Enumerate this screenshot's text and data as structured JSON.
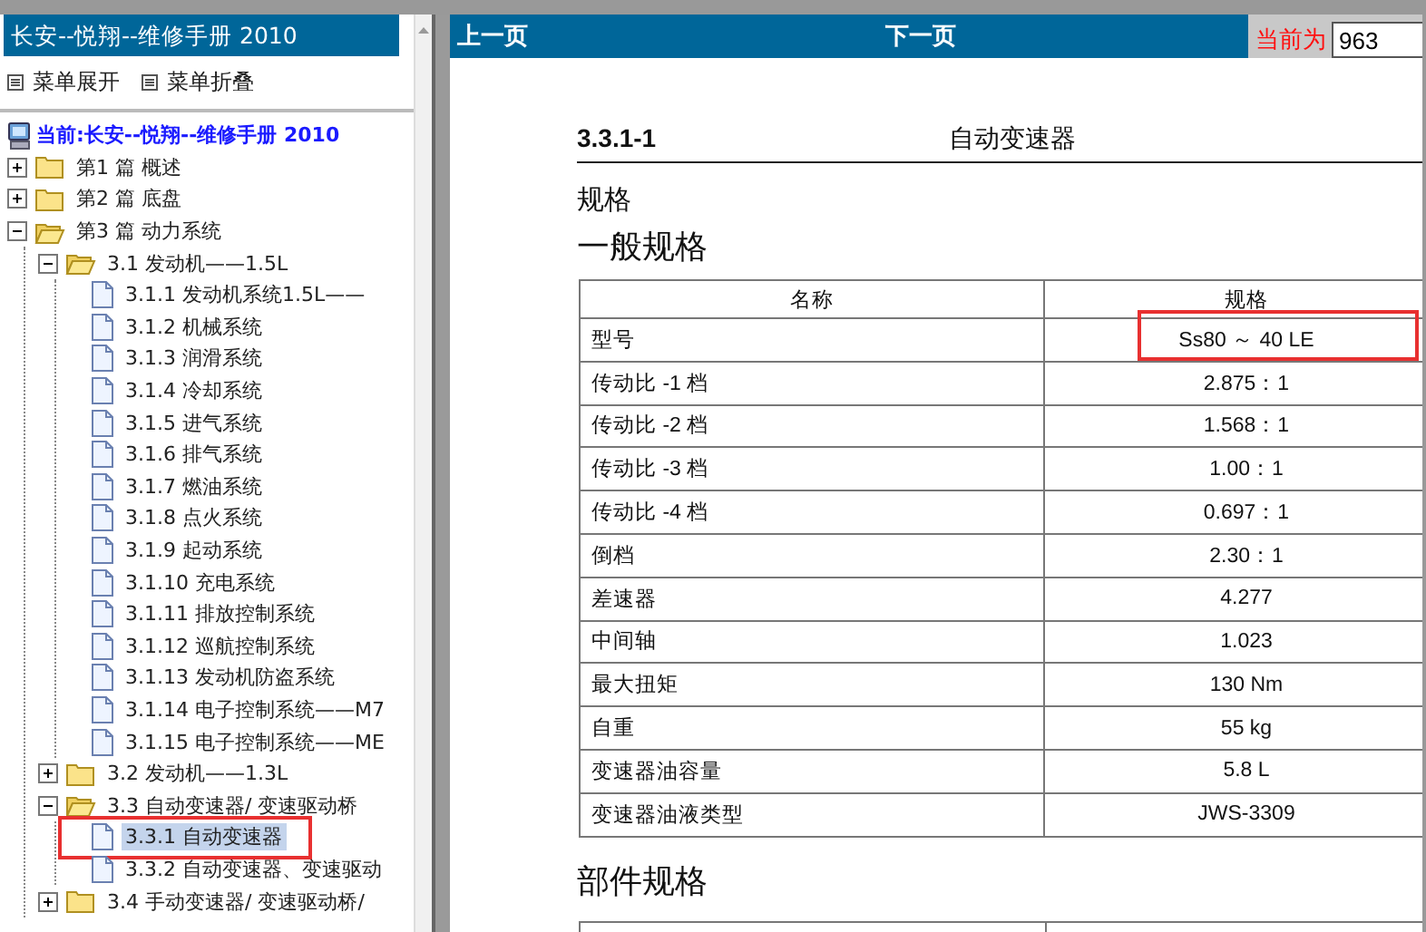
{
  "sidebar": {
    "title": "长安--悦翔--维修手册 2010",
    "menu_buttons": [
      "菜单展开",
      "菜单折叠"
    ],
    "root": "当前:长安--悦翔--维修手册 2010",
    "tree": [
      {
        "kind": "folder",
        "label": "第1 篇 概述",
        "expanded": false
      },
      {
        "kind": "folder",
        "label": "第2 篇 底盘",
        "expanded": false
      },
      {
        "kind": "folder",
        "label": "第3 篇 动力系统",
        "expanded": true,
        "children": [
          {
            "kind": "folder",
            "label": "3.1 发动机——1.5L",
            "expanded": true,
            "children": [
              {
                "kind": "page",
                "label": "3.1.1 发动机系统1.5L——",
                "selected": false,
                "annotated": false
              },
              {
                "kind": "page",
                "label": "3.1.2 机械系统",
                "selected": false,
                "annotated": false
              },
              {
                "kind": "page",
                "label": "3.1.3 润滑系统",
                "selected": false,
                "annotated": false
              },
              {
                "kind": "page",
                "label": "3.1.4 冷却系统",
                "selected": false,
                "annotated": false
              },
              {
                "kind": "page",
                "label": "3.1.5 进气系统",
                "selected": false,
                "annotated": false
              },
              {
                "kind": "page",
                "label": "3.1.6 排气系统",
                "selected": false,
                "annotated": false
              },
              {
                "kind": "page",
                "label": "3.1.7 燃油系统",
                "selected": false,
                "annotated": false
              },
              {
                "kind": "page",
                "label": "3.1.8 点火系统",
                "selected": false,
                "annotated": false
              },
              {
                "kind": "page",
                "label": "3.1.9 起动系统",
                "selected": false,
                "annotated": false
              },
              {
                "kind": "page",
                "label": "3.1.10 充电系统",
                "selected": false,
                "annotated": false
              },
              {
                "kind": "page",
                "label": "3.1.11 排放控制系统",
                "selected": false,
                "annotated": false
              },
              {
                "kind": "page",
                "label": "3.1.12 巡航控制系统",
                "selected": false,
                "annotated": false
              },
              {
                "kind": "page",
                "label": "3.1.13 发动机防盗系统",
                "selected": false,
                "annotated": false
              },
              {
                "kind": "page",
                "label": "3.1.14 电子控制系统——M7",
                "selected": false,
                "annotated": false
              },
              {
                "kind": "page",
                "label": "3.1.15 电子控制系统——ME",
                "selected": false,
                "annotated": false
              }
            ]
          },
          {
            "kind": "folder",
            "label": "3.2 发动机——1.3L",
            "expanded": false
          },
          {
            "kind": "folder",
            "label": "3.3 自动变速器/ 变速驱动桥",
            "expanded": true,
            "children": [
              {
                "kind": "page",
                "label": "3.3.1 自动变速器",
                "selected": true,
                "annotated": true
              },
              {
                "kind": "page",
                "label": "3.3.2 自动变速器、变速驱动",
                "selected": false,
                "annotated": false
              }
            ]
          },
          {
            "kind": "folder",
            "label": "3.4 手动变速器/ 变速驱动桥/",
            "expanded": false
          }
        ]
      }
    ]
  },
  "viewer": {
    "prev": "上一页",
    "next": "下一页",
    "current_label": "当前为",
    "current_page": "963",
    "document": {
      "section_number": "3.3.1-1",
      "section_title": "自动变速器",
      "heading": "规格",
      "subheading": "一般规格",
      "table": {
        "columns": [
          "名称",
          "规格"
        ],
        "rows": [
          {
            "name": "型号",
            "value": "Ss80 ～ 40 LE",
            "annotated": true
          },
          {
            "name": "传动比 -1 档",
            "value": "2.875：1",
            "annotated": false
          },
          {
            "name": "传动比 -2 档",
            "value": "1.568：1",
            "annotated": false
          },
          {
            "name": "传动比 -3 档",
            "value": "1.00：1",
            "annotated": false
          },
          {
            "name": "传动比 -4 档",
            "value": "0.697：1",
            "annotated": false
          },
          {
            "name": "倒档",
            "value": "2.30：1",
            "annotated": false
          },
          {
            "name": "差速器",
            "value": "4.277",
            "annotated": false
          },
          {
            "name": "中间轴",
            "value": "1.023",
            "annotated": false
          },
          {
            "name": "最大扭矩",
            "value": "130 Nm",
            "annotated": false
          },
          {
            "name": "自重",
            "value": "55 kg",
            "annotated": false
          },
          {
            "name": "变速器油容量",
            "value": "5.8 L",
            "annotated": false
          },
          {
            "name": "变速器油液类型",
            "value": "JWS-3309",
            "annotated": false
          }
        ]
      },
      "next_heading": "部件规格"
    }
  }
}
